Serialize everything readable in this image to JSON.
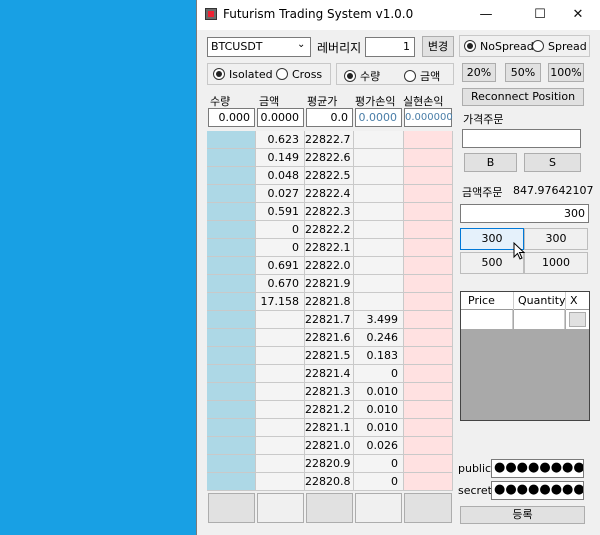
{
  "window": {
    "title": "Futurism Trading System v1.0.0",
    "minimize": "—",
    "maximize": "☐",
    "close": "✕"
  },
  "controls": {
    "symbol": "BTCUSDT",
    "leverage_label": "레버리지",
    "leverage_value": "1",
    "change_button": "변경",
    "margin_isolated": "Isolated",
    "margin_cross": "Cross",
    "qty_mode": "수량",
    "amount_mode": "금액",
    "nospread": "NoSpread",
    "spread": "Spread",
    "pct_buttons": [
      "20%",
      "50%",
      "100%"
    ],
    "reconnect": "Reconnect Position"
  },
  "position": {
    "headers": [
      "수량",
      "금액",
      "평균가",
      "평가손익",
      "실현손익"
    ],
    "values": [
      "0.000",
      "0.0000",
      "0.0",
      "0.0000",
      "0.000000"
    ]
  },
  "orderbook": [
    {
      "q": "",
      "sell": "0.623",
      "price": "22822.7",
      "buy": "",
      "r": ""
    },
    {
      "q": "",
      "sell": "0.149",
      "price": "22822.6",
      "buy": "",
      "r": ""
    },
    {
      "q": "",
      "sell": "0.048",
      "price": "22822.5",
      "buy": "",
      "r": ""
    },
    {
      "q": "",
      "sell": "0.027",
      "price": "22822.4",
      "buy": "",
      "r": ""
    },
    {
      "q": "",
      "sell": "0.591",
      "price": "22822.3",
      "buy": "",
      "r": ""
    },
    {
      "q": "",
      "sell": "0",
      "price": "22822.2",
      "buy": "",
      "r": ""
    },
    {
      "q": "",
      "sell": "0",
      "price": "22822.1",
      "buy": "",
      "r": ""
    },
    {
      "q": "",
      "sell": "0.691",
      "price": "22822.0",
      "buy": "",
      "r": ""
    },
    {
      "q": "",
      "sell": "0.670",
      "price": "22821.9",
      "buy": "",
      "r": ""
    },
    {
      "q": "",
      "sell": "17.158",
      "price": "22821.8",
      "buy": "",
      "r": ""
    },
    {
      "q": "",
      "sell": "",
      "price": "22821.7",
      "buy": "3.499",
      "r": ""
    },
    {
      "q": "",
      "sell": "",
      "price": "22821.6",
      "buy": "0.246",
      "r": ""
    },
    {
      "q": "",
      "sell": "",
      "price": "22821.5",
      "buy": "0.183",
      "r": ""
    },
    {
      "q": "",
      "sell": "",
      "price": "22821.4",
      "buy": "0",
      "r": ""
    },
    {
      "q": "",
      "sell": "",
      "price": "22821.3",
      "buy": "0.010",
      "r": ""
    },
    {
      "q": "",
      "sell": "",
      "price": "22821.2",
      "buy": "0.010",
      "r": ""
    },
    {
      "q": "",
      "sell": "",
      "price": "22821.1",
      "buy": "0.010",
      "r": ""
    },
    {
      "q": "",
      "sell": "",
      "price": "22821.0",
      "buy": "0.026",
      "r": ""
    },
    {
      "q": "",
      "sell": "",
      "price": "22820.9",
      "buy": "0",
      "r": ""
    },
    {
      "q": "",
      "sell": "",
      "price": "22820.8",
      "buy": "0",
      "r": ""
    }
  ],
  "order": {
    "price_order_label": "가격주문",
    "price_input": "",
    "buy_button": "B",
    "sell_button": "S",
    "amount_order_label": "금액주문",
    "amount_value": "847.97642107",
    "amount_input": "300",
    "presets": [
      "300",
      "300",
      "500",
      "1000"
    ]
  },
  "orders_table": {
    "headers": [
      "Price",
      "Quantity",
      "X"
    ]
  },
  "keys": {
    "public_label": "public",
    "public_value": "●●●●●●●●●",
    "secret_label": "secret",
    "secret_value": "●●●●●●●●●",
    "register_button": "등록"
  },
  "colors": {
    "desktop": "#18a0e4",
    "ask_cells": "#add8e6",
    "bid_cells": "#ffe1e1",
    "pnl_text": "#4a7ea8"
  }
}
